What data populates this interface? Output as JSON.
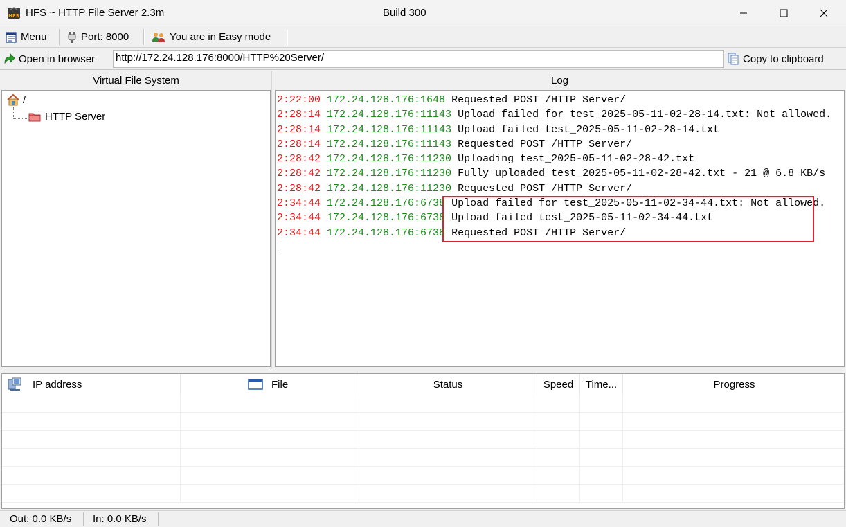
{
  "window": {
    "title": "HFS ~ HTTP File Server 2.3m",
    "build": "Build 300"
  },
  "toolbar": {
    "menu_label": "Menu",
    "port_label": "Port: 8000",
    "mode_label": "You are in Easy mode"
  },
  "address": {
    "open_label": "Open in browser",
    "url": "http://172.24.128.176:8000/HTTP%20Server/",
    "copy_label": "Copy to clipboard"
  },
  "vfs": {
    "title": "Virtual File System",
    "root_label": "/",
    "child_label": "HTTP Server"
  },
  "log": {
    "title": "Log",
    "lines": [
      {
        "time": "2:22:00",
        "ip": "172.24.128.176:1648",
        "msg": "Requested POST /HTTP Server/"
      },
      {
        "time": "2:28:14",
        "ip": "172.24.128.176:11143",
        "msg": "Upload failed for test_2025-05-11-02-28-14.txt: Not allowed."
      },
      {
        "time": "2:28:14",
        "ip": "172.24.128.176:11143",
        "msg": "Upload failed test_2025-05-11-02-28-14.txt"
      },
      {
        "time": "2:28:14",
        "ip": "172.24.128.176:11143",
        "msg": "Requested POST /HTTP Server/"
      },
      {
        "time": "2:28:42",
        "ip": "172.24.128.176:11230",
        "msg": "Uploading test_2025-05-11-02-28-42.txt"
      },
      {
        "time": "2:28:42",
        "ip": "172.24.128.176:11230",
        "msg": "Fully uploaded test_2025-05-11-02-28-42.txt - 21 @ 6.8 KB/s"
      },
      {
        "time": "2:28:42",
        "ip": "172.24.128.176:11230",
        "msg": "Requested POST /HTTP Server/"
      },
      {
        "time": "2:34:44",
        "ip": "172.24.128.176:6738",
        "msg": "Upload failed for test_2025-05-11-02-34-44.txt: Not allowed."
      },
      {
        "time": "2:34:44",
        "ip": "172.24.128.176:6738",
        "msg": "Upload failed test_2025-05-11-02-34-44.txt"
      },
      {
        "time": "2:34:44",
        "ip": "172.24.128.176:6738",
        "msg": "Requested POST /HTTP Server/"
      }
    ]
  },
  "connections": {
    "columns": [
      "IP address",
      "File",
      "Status",
      "Speed",
      "Time...",
      "Progress"
    ]
  },
  "status": {
    "out": "Out: 0.0 KB/s",
    "in": "In: 0.0 KB/s"
  },
  "colors": {
    "time": "#e01b1b",
    "ip": "#1a8a1a",
    "highlight": "#d9252e"
  }
}
